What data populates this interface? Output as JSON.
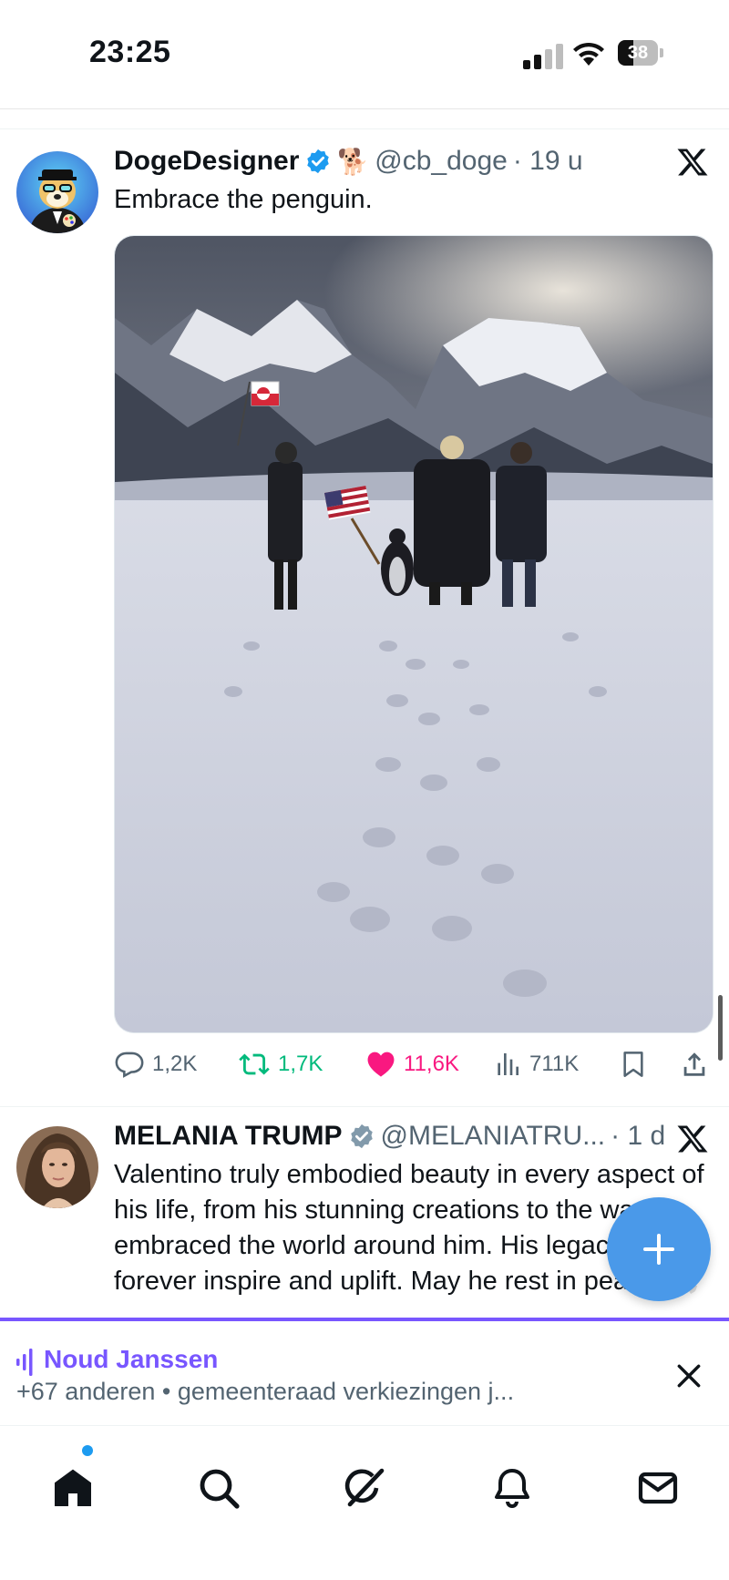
{
  "status": {
    "time": "23:25",
    "battery": "38",
    "battery_level": 0.38
  },
  "tweets": [
    {
      "name": "DogeDesigner",
      "emoji": "🐕",
      "handle": "@cb_doge",
      "time": "· 19 u",
      "text": "Embrace the penguin.",
      "stats": {
        "replies": "1,2K",
        "retweets": "1,7K",
        "likes": "11,6K",
        "views": "711K"
      }
    },
    {
      "name": "MELANIA TRUMP",
      "handle": "@MELANIATRU...",
      "time": "· 1 d",
      "text": "Valentino truly embodied beauty in every aspect of his life, from his stunning creations to the way he embraced the world around him. His legacy will forever inspire and uplift. May he rest in peace. 🕊️"
    }
  ],
  "space": {
    "host": "Noud Janssen",
    "subtitle": "+67 anderen • gemeenteraad verkiezingen j..."
  },
  "colors": {
    "accent": "#1d9bf0",
    "like": "#f91880",
    "retweet": "#00ba7c",
    "space": "#7856ff"
  },
  "nav": [
    "home-icon",
    "search-icon",
    "grok-icon",
    "notifications-icon",
    "messages-icon"
  ]
}
